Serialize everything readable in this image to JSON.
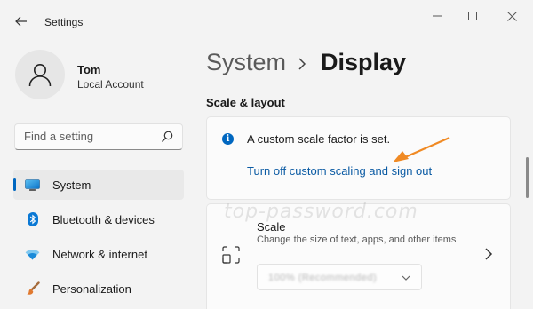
{
  "window": {
    "title": "Settings",
    "controls": [
      "minimize-icon",
      "maximize-icon",
      "close-icon"
    ]
  },
  "profile": {
    "name": "Tom",
    "account_type": "Local Account"
  },
  "search": {
    "placeholder": "Find a setting"
  },
  "sidebar": {
    "items": [
      {
        "label": "System",
        "icon": "monitor-icon",
        "active": true
      },
      {
        "label": "Bluetooth & devices",
        "icon": "bluetooth-icon",
        "active": false
      },
      {
        "label": "Network & internet",
        "icon": "wifi-icon",
        "active": false
      },
      {
        "label": "Personalization",
        "icon": "brush-icon",
        "active": false
      }
    ]
  },
  "breadcrumb": {
    "parent": "System",
    "current": "Display"
  },
  "section": {
    "title": "Scale & layout"
  },
  "notice": {
    "text": "A custom scale factor is set.",
    "link": "Turn off custom scaling and sign out"
  },
  "scale": {
    "title": "Scale",
    "description": "Change the size of text, apps, and other items",
    "selected_value": "100% (Recommended)"
  },
  "watermark": "top-password.com",
  "colors": {
    "accent": "#0067c0",
    "link": "#0a5aa3",
    "annotation_arrow": "#f08a24",
    "background": "#f3f3f3",
    "card": "#fbfbfb"
  }
}
